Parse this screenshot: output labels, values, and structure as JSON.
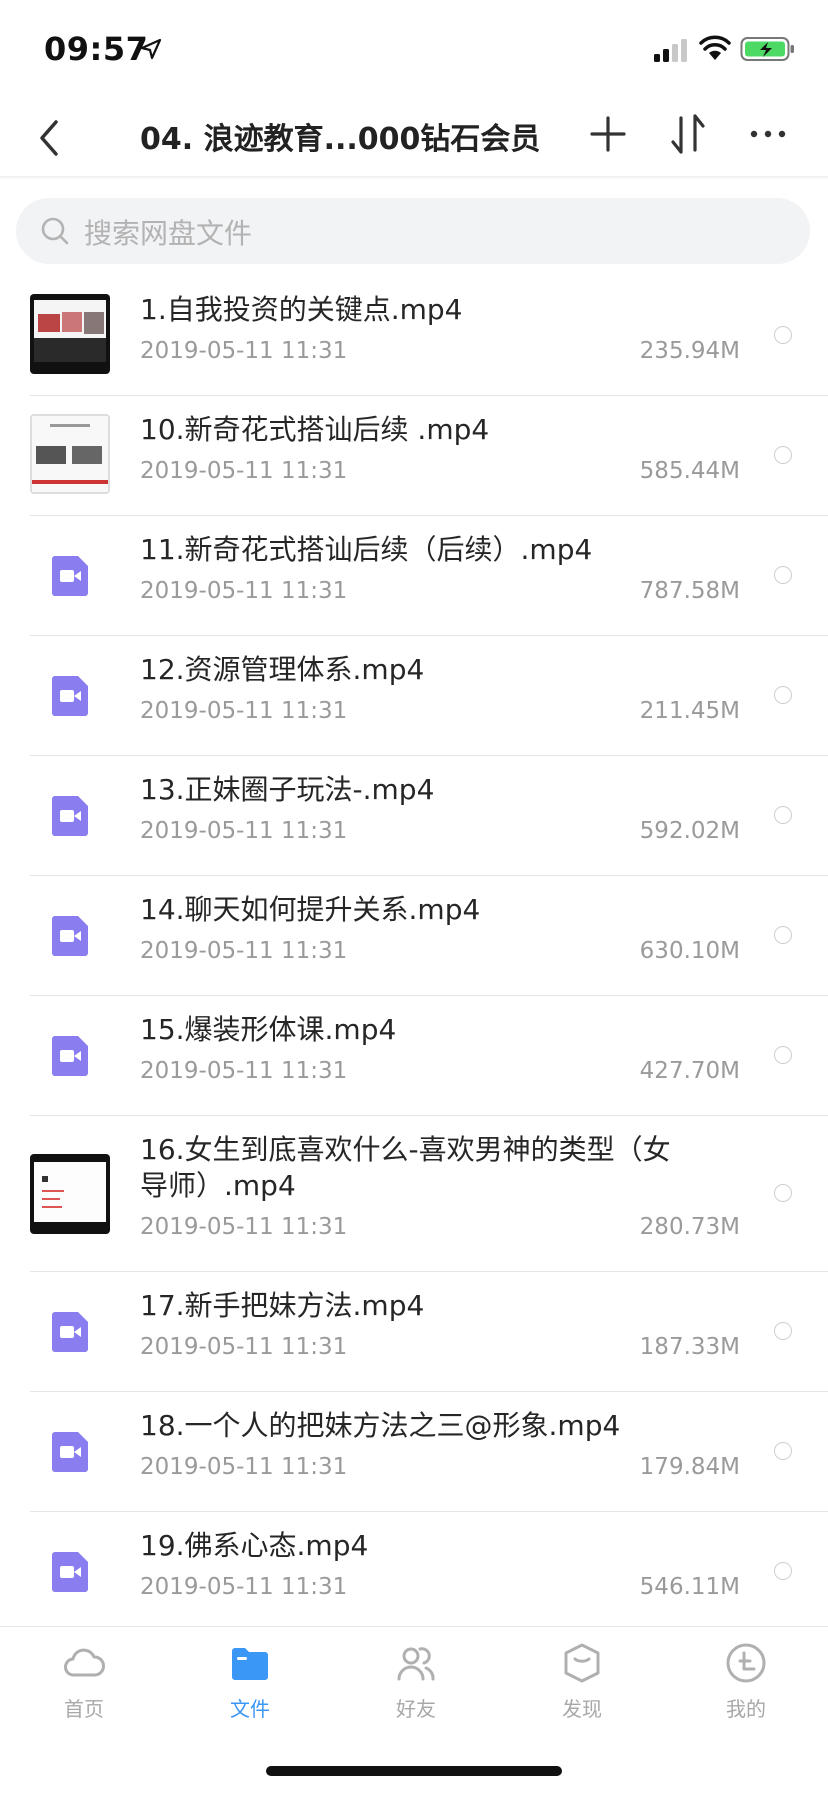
{
  "status_bar": {
    "time": "09:57"
  },
  "nav": {
    "title": "04. 浪迹教育...000钻石会员"
  },
  "search": {
    "placeholder": "搜索网盘文件"
  },
  "files": [
    {
      "name": "1.自我投资的关键点.mp4",
      "date": "2019-05-11 11:31",
      "size": "235.94M",
      "thumb": "video-thumbnail"
    },
    {
      "name": "10.新奇花式搭讪后续 .mp4",
      "date": "2019-05-11 11:31",
      "size": "585.44M",
      "thumb": "video-thumbnail"
    },
    {
      "name": "11.新奇花式搭讪后续（后续）.mp4",
      "date": "2019-05-11 11:31",
      "size": "787.58M",
      "thumb": "video-file-icon"
    },
    {
      "name": "12.资源管理体系.mp4",
      "date": "2019-05-11 11:31",
      "size": "211.45M",
      "thumb": "video-file-icon"
    },
    {
      "name": "13.正妹圈子玩法-.mp4",
      "date": "2019-05-11 11:31",
      "size": "592.02M",
      "thumb": "video-file-icon"
    },
    {
      "name": "14.聊天如何提升关系.mp4",
      "date": "2019-05-11 11:31",
      "size": "630.10M",
      "thumb": "video-file-icon"
    },
    {
      "name": "15.爆装形体课.mp4",
      "date": "2019-05-11 11:31",
      "size": "427.70M",
      "thumb": "video-file-icon"
    },
    {
      "name": "16.女生到底喜欢什么-喜欢男神的类型（女导师）.mp4",
      "date": "2019-05-11 11:31",
      "size": "280.73M",
      "thumb": "video-thumbnail"
    },
    {
      "name": "17.新手把妹方法.mp4",
      "date": "2019-05-11 11:31",
      "size": "187.33M",
      "thumb": "video-file-icon"
    },
    {
      "name": "18.一个人的把妹方法之三@形象.mp4",
      "date": "2019-05-11 11:31",
      "size": "179.84M",
      "thumb": "video-file-icon"
    },
    {
      "name": "19.佛系心态.mp4",
      "date": "2019-05-11 11:31",
      "size": "546.11M",
      "thumb": "video-file-icon"
    }
  ],
  "tabs": [
    {
      "label": "首页",
      "icon": "cloud-icon",
      "active": false
    },
    {
      "label": "文件",
      "icon": "folder-icon",
      "active": true
    },
    {
      "label": "好友",
      "icon": "friends-icon",
      "active": false
    },
    {
      "label": "发现",
      "icon": "discover-icon",
      "active": false
    },
    {
      "label": "我的",
      "icon": "profile-icon",
      "active": false
    }
  ],
  "colors": {
    "accent": "#3b97f5",
    "video_icon": "#8a7df0",
    "battery": "#4cd964"
  }
}
